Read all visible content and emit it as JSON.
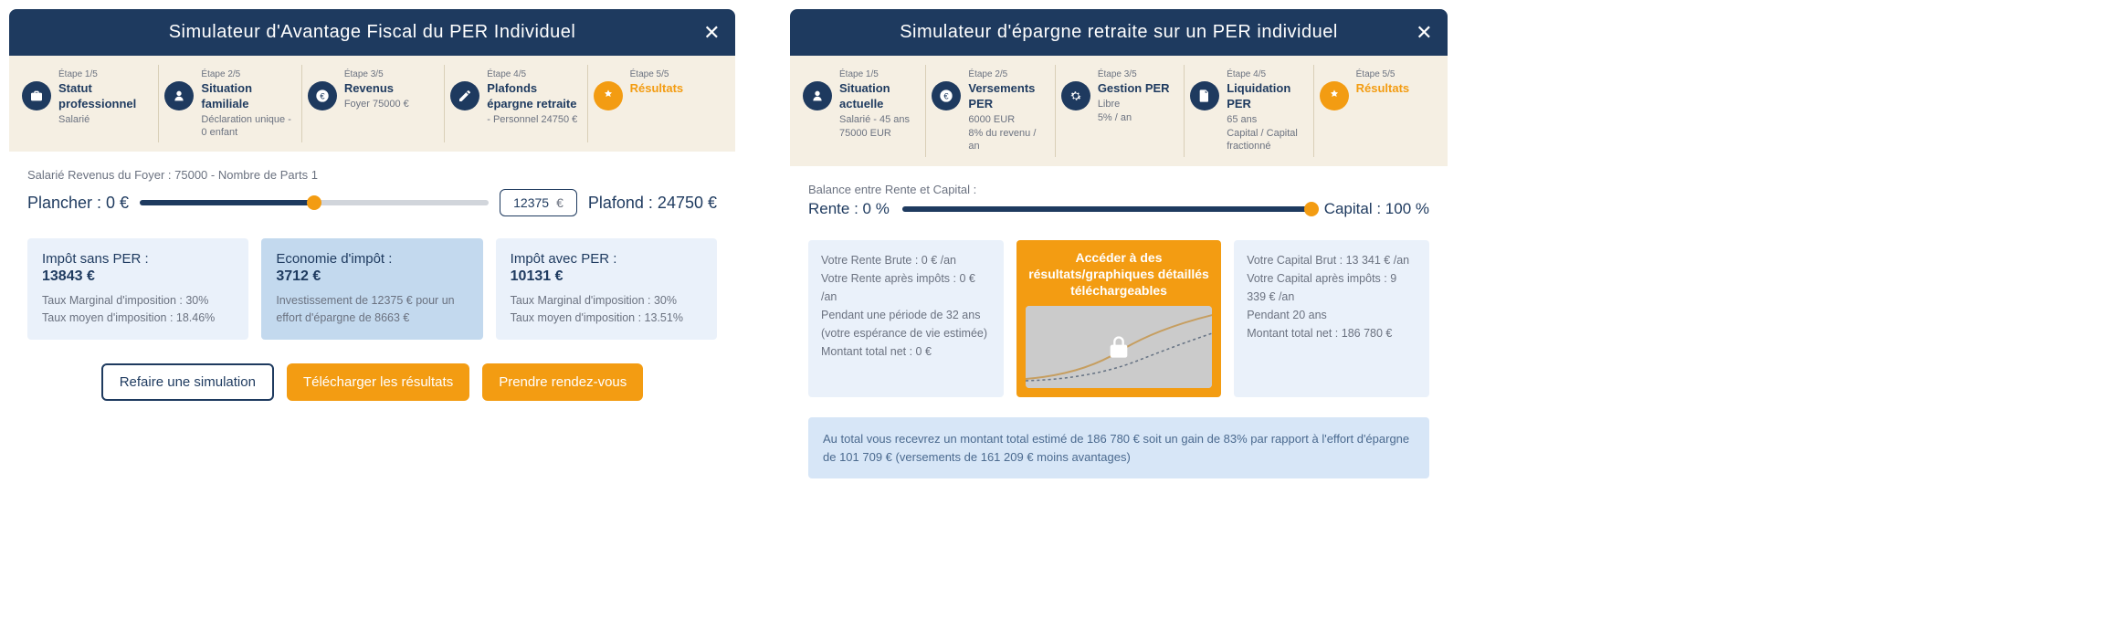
{
  "left": {
    "title": "Simulateur d'Avantage Fiscal du PER Individuel",
    "steps": [
      {
        "num": "Étape 1/5",
        "title": "Statut professionnel",
        "sub": "Salarié"
      },
      {
        "num": "Étape 2/5",
        "title": "Situation familiale",
        "sub": "Déclaration unique - 0 enfant"
      },
      {
        "num": "Étape 3/5",
        "title": "Revenus",
        "sub": "Foyer 75000 €"
      },
      {
        "num": "Étape 4/5",
        "title": "Plafonds épargne retraite",
        "sub": "- Personnel 24750 €"
      },
      {
        "num": "Étape 5/5",
        "title": "Résultats",
        "sub": ""
      }
    ],
    "summary": "Salarié Revenus du Foyer : 75000 - Nombre de Parts 1",
    "slider": {
      "min_label": "Plancher : 0 €",
      "max_label": "Plafond : 24750 €",
      "value": "12375",
      "unit": "€",
      "fill_pct": 50
    },
    "cards": {
      "without": {
        "title": "Impôt sans PER :",
        "value": "13843 €",
        "rate1": "Taux Marginal d'imposition : 30%",
        "rate2": "Taux moyen d'imposition : 18.46%"
      },
      "saving": {
        "title": "Economie d'impôt :",
        "value": "3712 €",
        "sub": "Investissement de 12375 € pour un effort d'épargne de 8663 €"
      },
      "with": {
        "title": "Impôt avec PER :",
        "value": "10131 €",
        "rate1": "Taux Marginal d'imposition : 30%",
        "rate2": "Taux moyen d'imposition : 13.51%"
      }
    },
    "buttons": {
      "redo": "Refaire une simulation",
      "download": "Télécharger les résultats",
      "appoint": "Prendre rendez-vous"
    }
  },
  "right": {
    "title": "Simulateur d'épargne retraite sur un PER individuel",
    "steps": [
      {
        "num": "Étape 1/5",
        "title": "Situation actuelle",
        "sub": "Salarié - 45 ans",
        "sub2": "75000 EUR"
      },
      {
        "num": "Étape 2/5",
        "title": "Versements PER",
        "sub": "6000 EUR",
        "sub2": "8% du revenu / an"
      },
      {
        "num": "Étape 3/5",
        "title": "Gestion PER",
        "sub": "Libre",
        "sub2": "5% / an"
      },
      {
        "num": "Étape 4/5",
        "title": "Liquidation PER",
        "sub": "65 ans",
        "sub2": "Capital / Capital fractionné"
      },
      {
        "num": "Étape 5/5",
        "title": "Résultats",
        "sub": "",
        "sub2": ""
      }
    ],
    "balance": {
      "label": "Balance entre Rente et Capital :",
      "rente": "Rente : 0 %",
      "capital": "Capital : 100 %"
    },
    "rente_box": {
      "l1": "Votre Rente Brute : 0 € /an",
      "l2": "Votre Rente après impôts : 0 € /an",
      "l3": "Pendant une période de 32 ans",
      "l4": "(votre espérance de vie estimée)",
      "l5": "Montant total net : 0 €"
    },
    "cta": "Accéder à des résultats/graphiques détaillés téléchargeables",
    "capital_box": {
      "l1": "Votre Capital Brut : 13 341 € /an",
      "l2": "Votre Capital après impôts : 9 339 € /an",
      "l3": "Pendant 20 ans",
      "l4": "Montant total net : 186 780 €"
    },
    "banner": "Au total vous recevrez un montant total estimé de 186 780 € soit un gain de 83% par rapport à l'effort d'épargne de 101 709 € (versements de 161 209 € moins avantages)"
  }
}
